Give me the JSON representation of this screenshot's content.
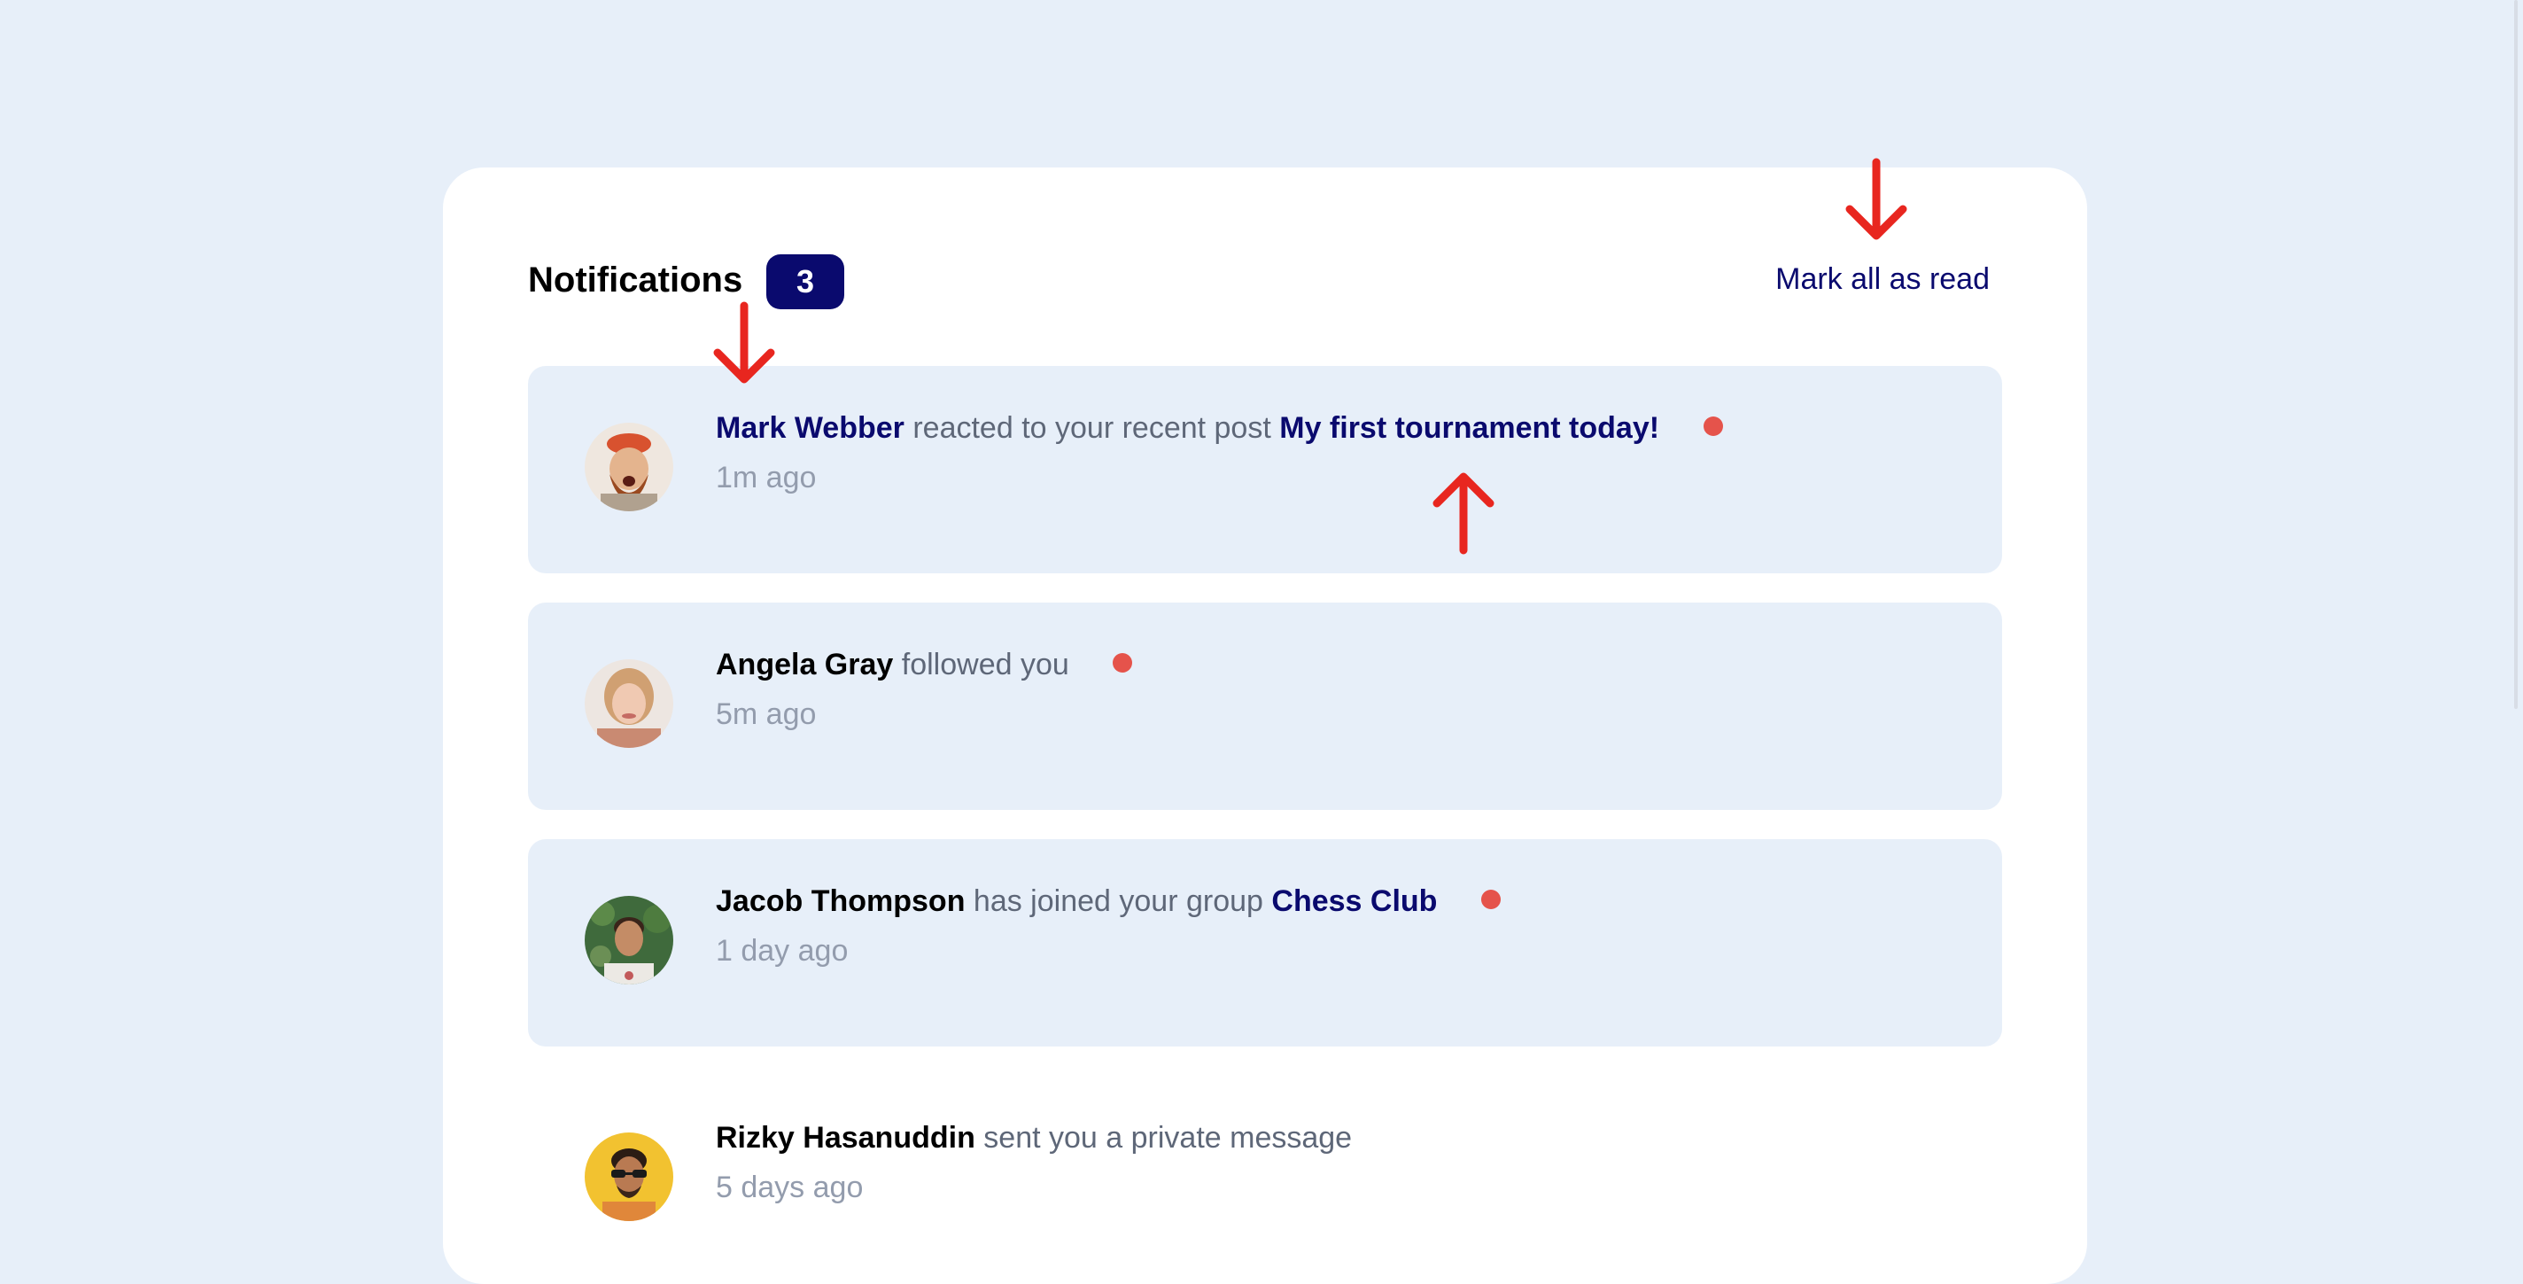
{
  "header": {
    "title": "Notifications",
    "unread_count": "3",
    "mark_all_label": "Mark all as read"
  },
  "notifications": [
    {
      "name": "Mark Webber",
      "action": "reacted to your recent post",
      "target": "My first tournament today!",
      "time": "1m ago",
      "unread": true
    },
    {
      "name": "Angela Gray",
      "action": "followed you",
      "target": "",
      "time": "5m ago",
      "unread": true
    },
    {
      "name": "Jacob Thompson",
      "action": "has joined your group",
      "target": "Chess Club",
      "time": "1 day ago",
      "unread": true
    },
    {
      "name": "Rizky Hasanuddin",
      "action": "sent you a private message",
      "target": "",
      "time": "5 days ago",
      "unread": false
    }
  ],
  "colors": {
    "background": "#e7eff9",
    "card": "#ffffff",
    "badge": "#0a0a6e",
    "accent_text": "#0a0a6e",
    "unread_dot": "#e5534b",
    "annotation_arrow": "#e8261f"
  }
}
